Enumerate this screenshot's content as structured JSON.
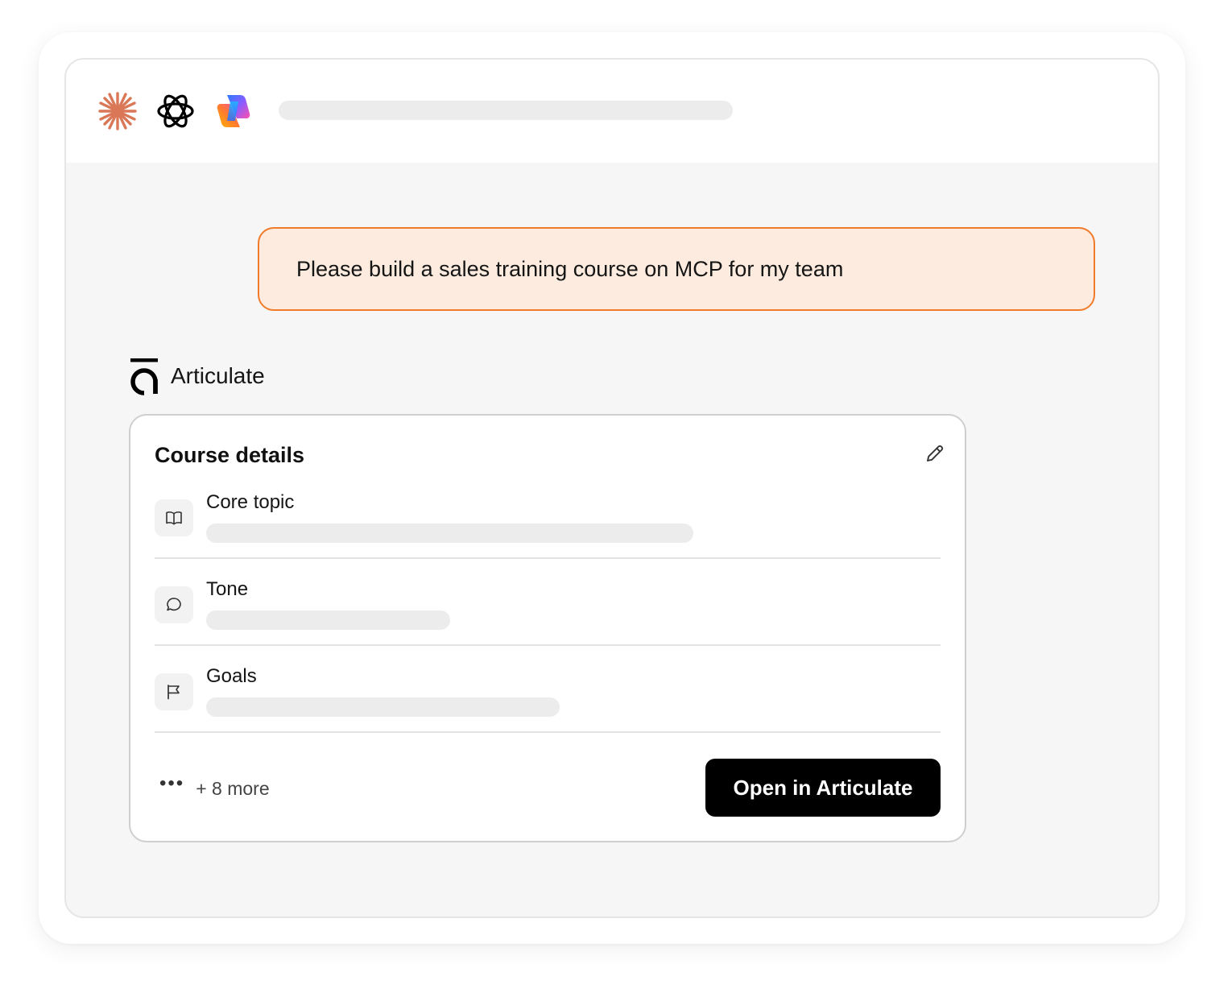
{
  "topbar": {
    "icons": [
      "claude-sparkle-icon",
      "openai-knot-icon",
      "copilot-icon"
    ],
    "colors": {
      "claude": "#d97757",
      "openai": "#000000",
      "copilot_gradient": [
        "#2b7bff",
        "#ff4fae",
        "#ffb400"
      ]
    }
  },
  "chat": {
    "user_message": "Please build a sales training course on MCP for my team",
    "bubble_colors": {
      "background": "#fcebde",
      "border": "#f07b2a"
    }
  },
  "assistant": {
    "name": "Articulate",
    "logo": "articulate-logo-icon"
  },
  "course_details": {
    "title": "Course details",
    "edit_icon": "pencil-icon",
    "rows": [
      {
        "label": "Core topic",
        "icon": "book-icon",
        "value_fill": 0.62
      },
      {
        "label": "Tone",
        "icon": "speech-bubble-icon",
        "value_fill": 0.31
      },
      {
        "label": "Goals",
        "icon": "flag-icon",
        "value_fill": 0.45
      }
    ],
    "more_icon": "ellipsis-icon",
    "more_label": "+ 8 more",
    "open_button_label": "Open in Articulate"
  }
}
